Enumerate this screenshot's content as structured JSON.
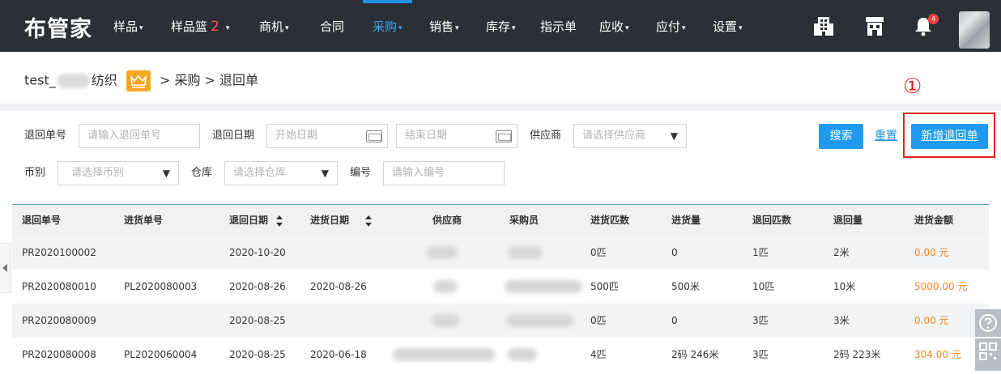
{
  "brand": {
    "logo_text": "布管家"
  },
  "nav": {
    "items": [
      {
        "label": "样品",
        "caret": "▾"
      },
      {
        "label": "样品篮",
        "badge": "2",
        "caret": "▾"
      },
      {
        "label": "商机",
        "caret": "▾"
      },
      {
        "label": "合同",
        "caret": ""
      },
      {
        "label": "采购",
        "caret": "▾",
        "active": true
      },
      {
        "label": "销售",
        "caret": "▾"
      },
      {
        "label": "库存",
        "caret": "▾"
      },
      {
        "label": "指示单",
        "caret": ""
      },
      {
        "label": "应收",
        "caret": "▾"
      },
      {
        "label": "应付",
        "caret": "▾"
      },
      {
        "label": "设置",
        "caret": "▾"
      }
    ],
    "notification_count": "4",
    "icons": [
      "building-icon",
      "store-icon",
      "bell-icon",
      "avatar"
    ],
    "active_color": "#3da8f5",
    "bar_color": "#2b2f36"
  },
  "breadcrumb": {
    "company_prefix": "test_",
    "company_suffix": "纺织",
    "separator": ">",
    "section": "采购",
    "page": "退回单"
  },
  "filters": {
    "return_no_label": "退回单号",
    "return_no_placeholder": "请输入退回单号",
    "return_date_label": "退回日期",
    "start_date_placeholder": "开始日期",
    "end_date_placeholder": "结束日期",
    "supplier_label": "供应商",
    "supplier_placeholder": "请选择供应商",
    "currency_label": "币别",
    "currency_placeholder": "请选择币别",
    "warehouse_label": "仓库",
    "warehouse_placeholder": "请选择仓库",
    "code_label": "编号",
    "code_placeholder": "请输入编号"
  },
  "actions": {
    "search_label": "搜索",
    "reset_label": "重置",
    "new_label": "新增退回单",
    "annotation_marker": "①",
    "primary_color": "#1e9bf0",
    "highlight_color": "#e0261d"
  },
  "table": {
    "headers": [
      "退回单号",
      "进货单号",
      "退回日期",
      "进货日期",
      "供应商",
      "采购员",
      "进货匹数",
      "进货量",
      "退回匹数",
      "退回量",
      "进货金额"
    ],
    "rows": [
      [
        "PR2020100002",
        "",
        "2020-10-20",
        "",
        "",
        "",
        "0匹",
        "0",
        "1匹",
        "2米",
        "0.00 元"
      ],
      [
        "PR2020080010",
        "PL2020080003",
        "2020-08-26",
        "2020-08-26",
        "",
        "",
        "500匹",
        "500米",
        "10匹",
        "10米",
        "5000.00 元"
      ],
      [
        "PR2020080009",
        "",
        "2020-08-25",
        "",
        "",
        "",
        "0匹",
        "0",
        "3匹",
        "3米",
        "0.00 元"
      ],
      [
        "PR2020080008",
        "PL2020060004",
        "2020-08-25",
        "2020-06-18",
        "",
        "",
        "4匹",
        "2码 246米",
        "3匹",
        "2码 223米",
        "304.00 元"
      ]
    ],
    "amount_color": "#f5841f"
  }
}
